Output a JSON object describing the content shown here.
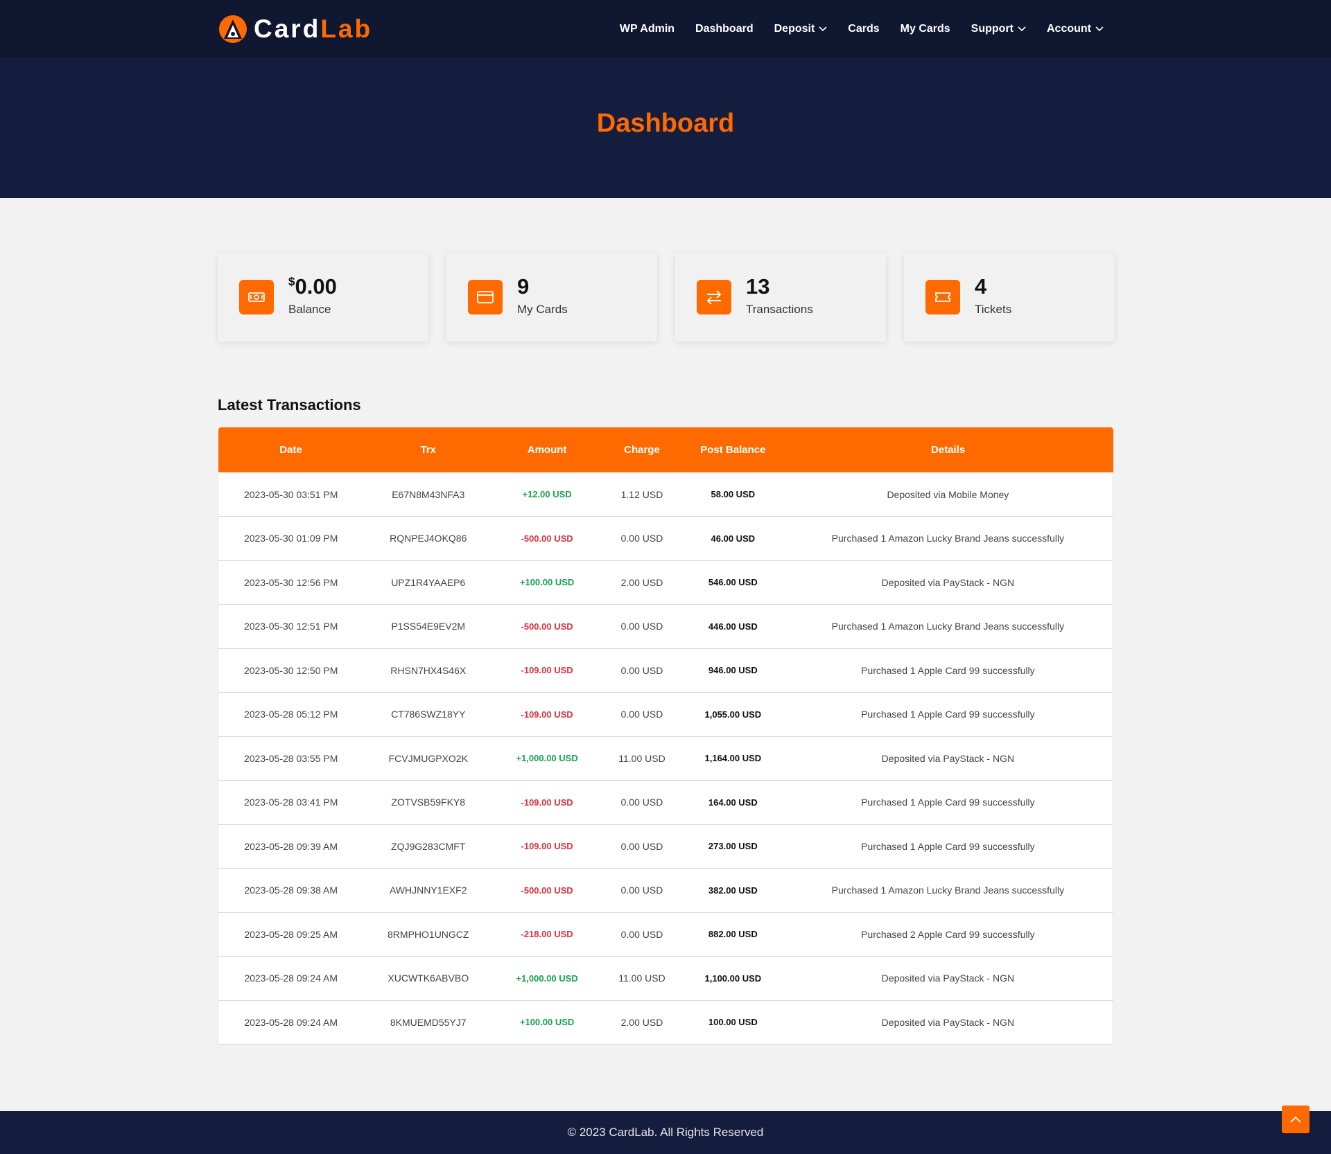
{
  "brand": {
    "part1": "Card",
    "part2": "Lab"
  },
  "nav": {
    "items": [
      {
        "label": "WP Admin",
        "dropdown": false
      },
      {
        "label": "Dashboard",
        "dropdown": false
      },
      {
        "label": "Deposit",
        "dropdown": true
      },
      {
        "label": "Cards",
        "dropdown": false
      },
      {
        "label": "My Cards",
        "dropdown": false
      },
      {
        "label": "Support",
        "dropdown": true
      },
      {
        "label": "Account",
        "dropdown": true
      }
    ]
  },
  "hero": {
    "title": "Dashboard"
  },
  "stats": [
    {
      "currency": "$",
      "value": "0.00",
      "label": "Balance",
      "icon": "money-icon"
    },
    {
      "currency": "",
      "value": "9",
      "label": "My Cards",
      "icon": "card-icon"
    },
    {
      "currency": "",
      "value": "13",
      "label": "Transactions",
      "icon": "transfer-icon"
    },
    {
      "currency": "",
      "value": "4",
      "label": "Tickets",
      "icon": "ticket-icon"
    }
  ],
  "transactions": {
    "title": "Latest Transactions",
    "columns": [
      "Date",
      "Trx",
      "Amount",
      "Charge",
      "Post Balance",
      "Details"
    ],
    "rows": [
      {
        "date": "2023-05-30 03:51 PM",
        "trx": "E67N8M43NFA3",
        "amount": "+12.00 USD",
        "type": "pos",
        "charge": "1.12 USD",
        "post_balance": "58.00 USD",
        "details": "Deposited via Mobile Money"
      },
      {
        "date": "2023-05-30 01:09 PM",
        "trx": "RQNPEJ4OKQ86",
        "amount": "-500.00 USD",
        "type": "neg",
        "charge": "0.00 USD",
        "post_balance": "46.00 USD",
        "details": "Purchased 1 Amazon Lucky Brand Jeans successfully"
      },
      {
        "date": "2023-05-30 12:56 PM",
        "trx": "UPZ1R4YAAEP6",
        "amount": "+100.00 USD",
        "type": "pos",
        "charge": "2.00 USD",
        "post_balance": "546.00 USD",
        "details": "Deposited via PayStack - NGN"
      },
      {
        "date": "2023-05-30 12:51 PM",
        "trx": "P1SS54E9EV2M",
        "amount": "-500.00 USD",
        "type": "neg",
        "charge": "0.00 USD",
        "post_balance": "446.00 USD",
        "details": "Purchased 1 Amazon Lucky Brand Jeans successfully"
      },
      {
        "date": "2023-05-30 12:50 PM",
        "trx": "RHSN7HX4S46X",
        "amount": "-109.00 USD",
        "type": "neg",
        "charge": "0.00 USD",
        "post_balance": "946.00 USD",
        "details": "Purchased 1 Apple Card 99 successfully"
      },
      {
        "date": "2023-05-28 05:12 PM",
        "trx": "CT786SWZ18YY",
        "amount": "-109.00 USD",
        "type": "neg",
        "charge": "0.00 USD",
        "post_balance": "1,055.00 USD",
        "details": "Purchased 1 Apple Card 99 successfully"
      },
      {
        "date": "2023-05-28 03:55 PM",
        "trx": "FCVJMUGPXO2K",
        "amount": "+1,000.00 USD",
        "type": "pos",
        "charge": "11.00 USD",
        "post_balance": "1,164.00 USD",
        "details": "Deposited via PayStack - NGN"
      },
      {
        "date": "2023-05-28 03:41 PM",
        "trx": "ZOTVSB59FKY8",
        "amount": "-109.00 USD",
        "type": "neg",
        "charge": "0.00 USD",
        "post_balance": "164.00 USD",
        "details": "Purchased 1 Apple Card 99 successfully"
      },
      {
        "date": "2023-05-28 09:39 AM",
        "trx": "ZQJ9G283CMFT",
        "amount": "-109.00 USD",
        "type": "neg",
        "charge": "0.00 USD",
        "post_balance": "273.00 USD",
        "details": "Purchased 1 Apple Card 99 successfully"
      },
      {
        "date": "2023-05-28 09:38 AM",
        "trx": "AWHJNNY1EXF2",
        "amount": "-500.00 USD",
        "type": "neg",
        "charge": "0.00 USD",
        "post_balance": "382.00 USD",
        "details": "Purchased 1 Amazon Lucky Brand Jeans successfully"
      },
      {
        "date": "2023-05-28 09:25 AM",
        "trx": "8RMPHO1UNGCZ",
        "amount": "-218.00 USD",
        "type": "neg",
        "charge": "0.00 USD",
        "post_balance": "882.00 USD",
        "details": "Purchased 2 Apple Card 99 successfully"
      },
      {
        "date": "2023-05-28 09:24 AM",
        "trx": "XUCWTK6ABVBO",
        "amount": "+1,000.00 USD",
        "type": "pos",
        "charge": "11.00 USD",
        "post_balance": "1,100.00 USD",
        "details": "Deposited via PayStack - NGN"
      },
      {
        "date": "2023-05-28 09:24 AM",
        "trx": "8KMUEMD55YJ7",
        "amount": "+100.00 USD",
        "type": "pos",
        "charge": "2.00 USD",
        "post_balance": "100.00 USD",
        "details": "Deposited via PayStack - NGN"
      }
    ]
  },
  "footer": {
    "text": "© 2023 CardLab. All Rights Reserved"
  },
  "scroll_top": {
    "icon": "chevron-up-icon"
  },
  "colors": {
    "accent": "#ff6a00",
    "navy": "#0f1731",
    "hero": "#141d3d",
    "positive": "#16a34a",
    "negative": "#e0303a"
  }
}
